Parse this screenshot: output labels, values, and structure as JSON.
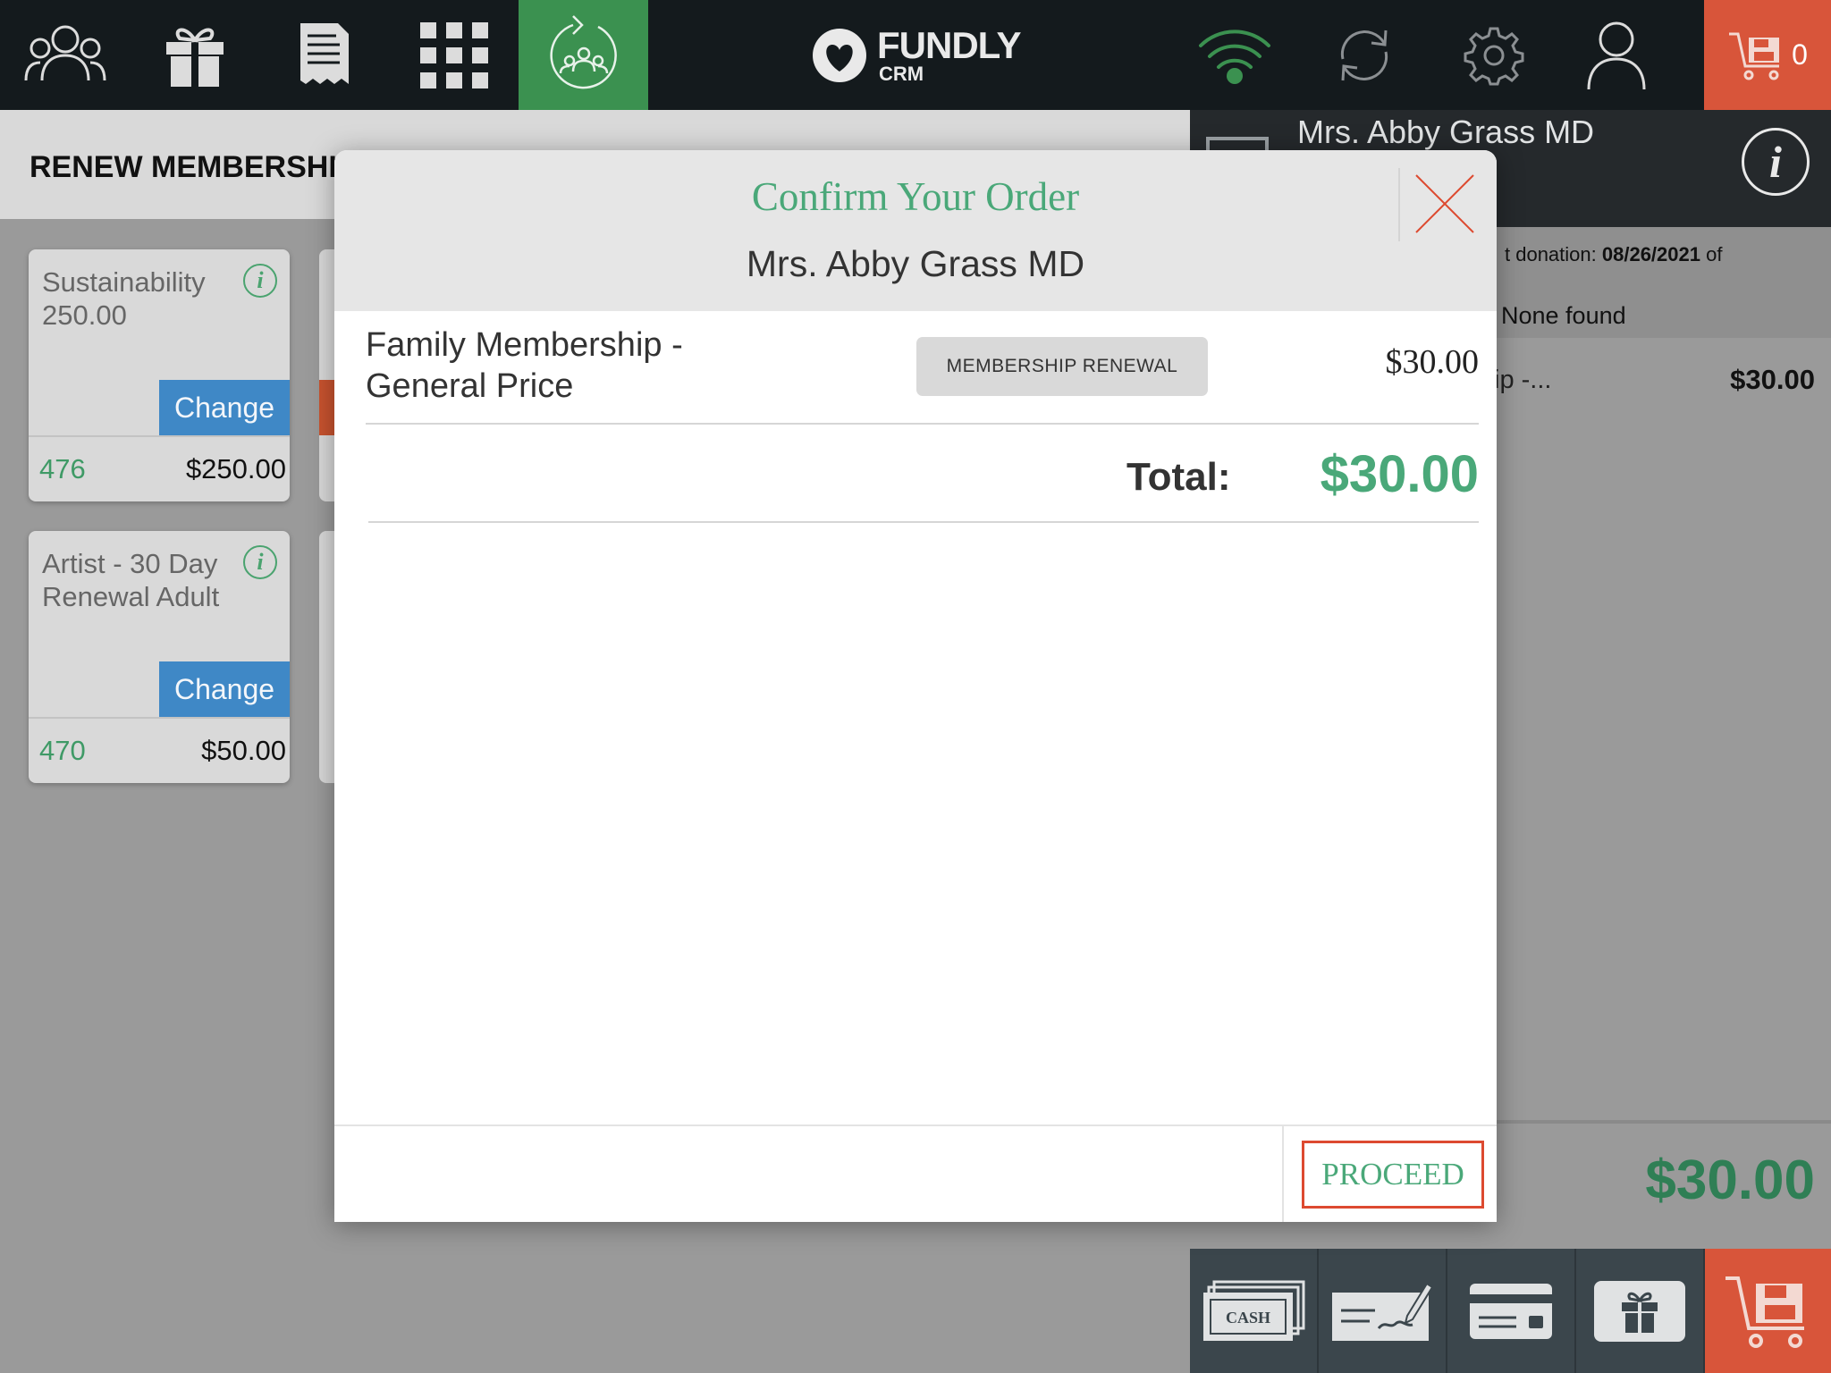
{
  "app": {
    "logo_title": "FUNDLY",
    "logo_subtitle": "CRM",
    "cart_count": "0",
    "colors": {
      "topbar": "#141a1d",
      "active_nav": "#3b9150",
      "cart": "#d8553a",
      "accent_green": "#4aa879",
      "change_blue": "#3f88c6"
    }
  },
  "nav": {
    "items": [
      {
        "icon": "people-icon"
      },
      {
        "icon": "gift-icon"
      },
      {
        "icon": "receipt-icon"
      },
      {
        "icon": "grid-icon"
      },
      {
        "icon": "renew-membership-icon",
        "active": true
      }
    ],
    "right_items": [
      {
        "icon": "wifi-icon"
      },
      {
        "icon": "sync-icon"
      },
      {
        "icon": "gear-icon"
      },
      {
        "icon": "user-icon"
      },
      {
        "icon": "cart-icon"
      }
    ]
  },
  "main": {
    "page_title": "RENEW MEMBERSHI",
    "cards": [
      {
        "name": "Sustainability 250.00",
        "change_label": "Change",
        "id": "476",
        "price": "$250.00"
      },
      {
        "name": "Artist - 30 Day Renewal Adult",
        "change_label": "Change",
        "id": "470",
        "price": "$50.00"
      }
    ],
    "info_glyph": "i"
  },
  "right_panel": {
    "customer_name": "Mrs. Abby Grass MD",
    "info_glyph": "i",
    "last_donation_label": "t donation: ",
    "last_donation_date": "08/26/2021",
    "last_donation_suffix": " of",
    "none_found": "None found",
    "line_item_name": "ip -...",
    "line_item_price": "$30.00",
    "total": "$30.00",
    "pay_buttons": [
      {
        "icon": "cash-icon",
        "label": "CASH"
      },
      {
        "icon": "check-icon"
      },
      {
        "icon": "credit-card-icon"
      },
      {
        "icon": "gift-card-icon"
      },
      {
        "icon": "checkout-cart-icon"
      }
    ]
  },
  "modal": {
    "title": "Confirm Your Order",
    "customer_name": "Mrs. Abby Grass MD",
    "order_items": [
      {
        "name": "Family Membership - General Price",
        "type": "MEMBERSHIP RENEWAL",
        "price": "$30.00"
      }
    ],
    "total_label": "Total:",
    "total_value": "$30.00",
    "proceed_label": "PROCEED"
  }
}
